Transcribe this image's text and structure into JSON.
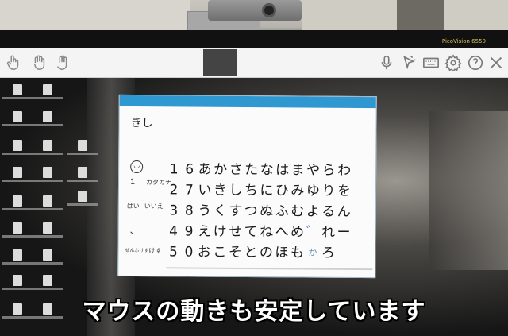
{
  "top_bezel": {
    "brand": "PicoVision 6550"
  },
  "toolbar": {
    "left_icons": [
      "hand-tap-icon",
      "hand-grab-icon",
      "hand-swipe-icon"
    ],
    "right_icons": [
      "microphone-icon",
      "pointer-icon",
      "keyboard-icon",
      "settings-icon",
      "help-icon",
      "close-icon"
    ]
  },
  "keyboard_panel": {
    "input_text": "きし",
    "left_labels": {
      "one": "1",
      "hai": "はい",
      "iie": "いいえ",
      "comma": "、",
      "sakujo": "ぜんぶけす",
      "kesu": "けす",
      "kana": "カタカナ"
    },
    "rows": [
      [
        "1",
        "6",
        "あ",
        "か",
        "さ",
        "た",
        "な",
        "は",
        "ま",
        "や",
        "ら",
        "わ"
      ],
      [
        "2",
        "7",
        "い",
        "き",
        "し",
        "ち",
        "に",
        "ひ",
        "み",
        "ゆ",
        "り",
        "を"
      ],
      [
        "3",
        "8",
        "う",
        "く",
        "す",
        "つ",
        "ぬ",
        "ふ",
        "む",
        "よ",
        "る",
        "ん"
      ],
      [
        "4",
        "9",
        "え",
        "け",
        "せ",
        "て",
        "ね",
        "へ",
        "め",
        "゛",
        "れ",
        "ー"
      ],
      [
        "5",
        "0",
        "お",
        "こ",
        "そ",
        "と",
        "の",
        "ほ",
        "も",
        "か",
        "ろ",
        ""
      ]
    ]
  },
  "subtitle": "マウスの動きも安定しています"
}
